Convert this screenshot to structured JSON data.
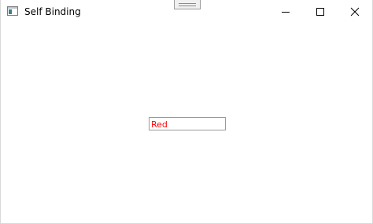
{
  "window": {
    "title": "Self Binding",
    "icon": "window-app-icon",
    "controls": [
      "minimize-icon",
      "maximize-icon",
      "close-icon"
    ]
  },
  "textbox": {
    "value": "Red",
    "text_color": "#ff0000"
  }
}
